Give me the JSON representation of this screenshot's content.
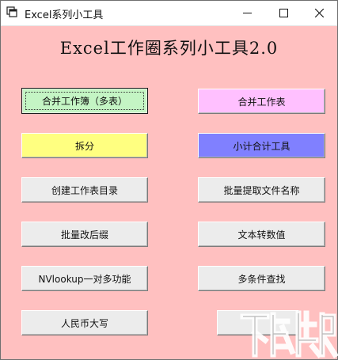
{
  "window": {
    "title": "Excel系列小工具",
    "controls": {
      "minimize_icon": "minimize-icon",
      "maximize_icon": "maximize-icon",
      "close_icon": "close-icon"
    }
  },
  "heading": "Excel工作圈系列小工具2.0",
  "buttons": {
    "merge_workbooks": "合并工作簿（多表）",
    "merge_worksheets": "合并工作表",
    "split": "拆分",
    "subtotal_tool": "小计合计工具",
    "create_sheet_index": "创建工作表目录",
    "batch_extract_filenames": "批量提取文件名称",
    "batch_change_suffix": "批量改后缀",
    "text_to_number": "文本转数值",
    "vlookup_one_to_many": "NVlookup一对多功能",
    "multi_condition_lookup": "多条件查找",
    "rmb_uppercase": "人民币大写"
  },
  "colors": {
    "window_bg": "#ffc0c0",
    "merge_workbooks_bg": "#c4f5c4",
    "merge_worksheets_bg": "#ffc0ff",
    "split_bg": "#ffff80",
    "subtotal_tool_bg": "#8080ff",
    "default_button_bg": "#ececec"
  },
  "watermark": {
    "icon": "site-logo-watermark"
  }
}
